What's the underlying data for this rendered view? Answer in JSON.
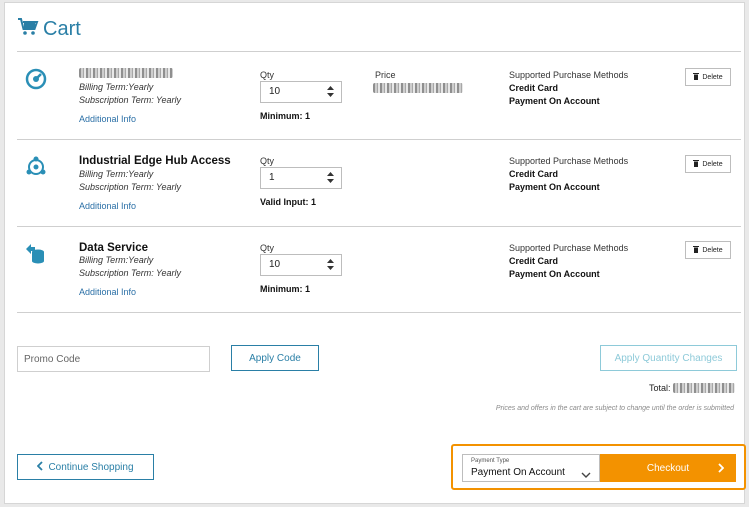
{
  "header": {
    "title": "Cart"
  },
  "colors": {
    "accent": "#2a7fa6",
    "checkout": "#f39200"
  },
  "items": [
    {
      "name": "",
      "billing": "Billing Term:Yearly",
      "subscription": "Subscription Term: Yearly",
      "info_link": "Additional Info",
      "qty_label": "Qty",
      "qty_value": "10",
      "qty_note": "Minimum: 1",
      "price_label": "Price",
      "methods_label": "Supported Purchase Methods",
      "method1": "Credit Card",
      "method2": "Payment On Account",
      "delete_label": "Delete",
      "icon": "dashboard-gauge-icon"
    },
    {
      "name": "Industrial Edge Hub Access",
      "billing": "Billing Term:Yearly",
      "subscription": "Subscription Term: Yearly",
      "info_link": "Additional Info",
      "qty_label": "Qty",
      "qty_value": "1",
      "qty_note": "Valid Input: 1",
      "methods_label": "Supported Purchase Methods",
      "method1": "Credit Card",
      "method2": "Payment On Account",
      "delete_label": "Delete",
      "icon": "hub-network-icon"
    },
    {
      "name": "Data Service",
      "billing": "Billing Term:Yearly",
      "subscription": "Subscription Term: Yearly",
      "info_link": "Additional Info",
      "qty_label": "Qty",
      "qty_value": "10",
      "qty_note": "Minimum: 1",
      "methods_label": "Supported Purchase Methods",
      "method1": "Credit Card",
      "method2": "Payment On Account",
      "delete_label": "Delete",
      "icon": "database-icon"
    }
  ],
  "promo": {
    "placeholder": "Promo Code",
    "apply_label": "Apply Code"
  },
  "apply_qty_label": "Apply Quantity Changes",
  "total_label": "Total:",
  "note": "Prices and offers in the cart are subject to change until the order is submitted",
  "footer": {
    "continue_label": "Continue Shopping",
    "payment_type_label": "Payment Type",
    "payment_type_value": "Payment On Account",
    "checkout_label": "Checkout"
  }
}
